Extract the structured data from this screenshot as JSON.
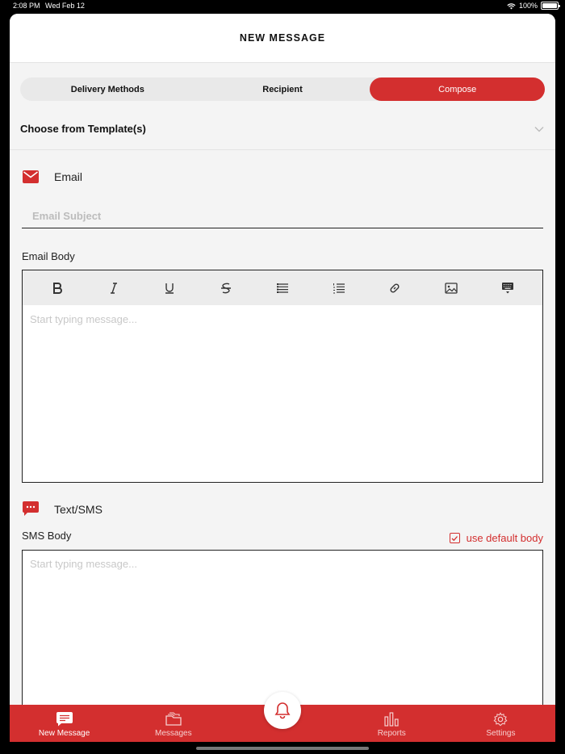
{
  "status_bar": {
    "time": "2:08 PM",
    "date": "Wed Feb 12",
    "battery": "100%"
  },
  "header": {
    "title": "NEW MESSAGE"
  },
  "segments": [
    {
      "label": "Delivery Methods",
      "active": false
    },
    {
      "label": "Recipient",
      "active": false
    },
    {
      "label": "Compose",
      "active": true
    }
  ],
  "template": {
    "label": "Choose from Template(s)"
  },
  "email": {
    "section_title": "Email",
    "subject_placeholder": "Email Subject",
    "body_label": "Email Body",
    "body_placeholder": "Start typing message...",
    "toolbar": [
      "bold-icon",
      "italic-icon",
      "underline-icon",
      "strikethrough-icon",
      "bullet-list-icon",
      "numbered-list-icon",
      "link-icon",
      "image-icon",
      "keyboard-icon"
    ]
  },
  "sms": {
    "section_title": "Text/SMS",
    "body_label": "SMS Body",
    "default_body_label": "use default body",
    "default_body_checked": true,
    "body_placeholder": "Start typing message..."
  },
  "tabbar": {
    "items": [
      {
        "label": "New Message",
        "icon": "message-icon",
        "active": true
      },
      {
        "label": "Messages",
        "icon": "folder-icon",
        "active": false
      },
      {
        "label": "",
        "icon": "bell-icon",
        "active": false
      },
      {
        "label": "Reports",
        "icon": "bar-chart-icon",
        "active": false
      },
      {
        "label": "Settings",
        "icon": "gear-icon",
        "active": false
      }
    ]
  },
  "colors": {
    "accent": "#d32f2f",
    "background": "#f4f4f4"
  }
}
